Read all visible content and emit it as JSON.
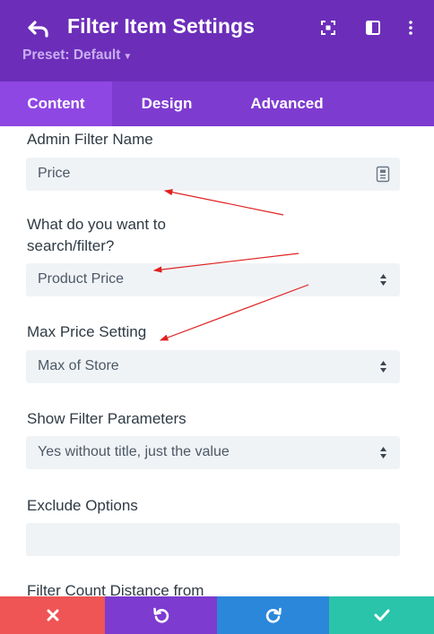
{
  "header": {
    "title": "Filter Item Settings",
    "preset_label": "Preset: Default",
    "background": "#6c2eb9",
    "icons": [
      "undo-arrow-icon",
      "focus-icon",
      "split-panel-icon",
      "more-vertical-icon"
    ]
  },
  "tabs": [
    {
      "label": "Content",
      "active": true
    },
    {
      "label": "Design",
      "active": false
    },
    {
      "label": "Advanced",
      "active": false
    }
  ],
  "fields": {
    "admin_filter_name": {
      "label": "Admin Filter Name",
      "value": "Price"
    },
    "search_filter": {
      "label_line1": "What do you want to",
      "label_line2": "search/filter?",
      "value": "Product Price"
    },
    "max_price": {
      "label": "Max Price Setting",
      "value": "Max of Store"
    },
    "show_params": {
      "label": "Show Filter Parameters",
      "value": "Yes without title, just the value"
    },
    "exclude": {
      "label": "Exclude Options",
      "value": ""
    },
    "count_distance": {
      "label": "Filter Count Distance from"
    }
  },
  "footer": {
    "buttons": [
      "discard",
      "undo",
      "redo",
      "save"
    ],
    "colors": {
      "discard": "#ef5555",
      "undo": "#7d3bcf",
      "redo": "#2b87da",
      "save": "#29c4a9"
    }
  },
  "annotation_color": "#e02020"
}
